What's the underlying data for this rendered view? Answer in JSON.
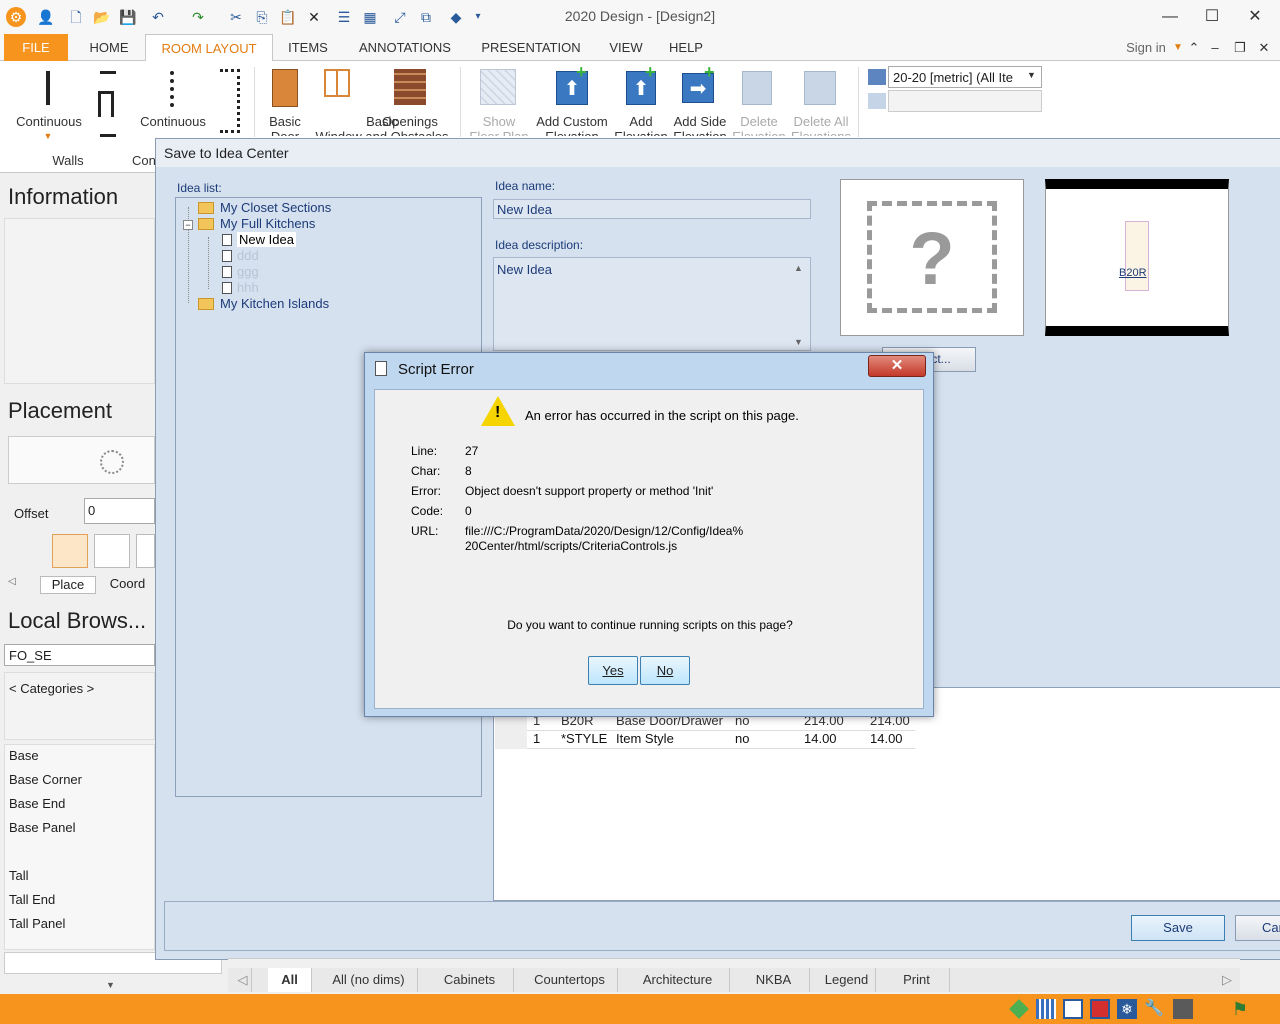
{
  "window": {
    "title": "2020 Design - [Design2]"
  },
  "ribbon_tabs": [
    "FILE",
    "HOME",
    "ROOM LAYOUT",
    "ITEMS",
    "ANNOTATIONS",
    "PRESENTATION",
    "VIEW",
    "HELP"
  ],
  "sign_in": "Sign in",
  "ribbon": {
    "continuous_walls": "Continuous",
    "walls_group": "Walls",
    "continuous2": "Continuous",
    "con_group": "Con",
    "basic_door": "Basic\nDoor",
    "basic_window": "Basic\nWindow and Obstacles",
    "openings": "Openings",
    "show_floor_plan": "Show\nFloor Plan",
    "add_custom_elevation": "Add Custom\nElevation",
    "add_elevation": "Add\nElevation",
    "add_side_elevation": "Add Side\nElevation",
    "delete_elevation": "Delete\nElevation",
    "delete_all_elevations": "Delete All\nElevations",
    "catalog_combo": "20-20 [metric] (All Ite"
  },
  "left": {
    "information": "Information",
    "placement": "Placement",
    "offset_label": "Offset",
    "offset_value": "0",
    "place_tab": "Place",
    "coord_tab": "Coord",
    "local_browser": "Local Brows...",
    "filter_value": "FO_SE",
    "categories": "< Categories >",
    "items": [
      "Base",
      "Base Corner",
      "Base End",
      "Base Panel",
      "",
      "Tall",
      "Tall End",
      "Tall Panel"
    ]
  },
  "save_dialog": {
    "title": "Save to Idea Center",
    "idea_list_label": "Idea list:",
    "tree": [
      "My Closet Sections",
      "My Full Kitchens",
      "New Idea",
      "ddd",
      "ggg",
      "hhh",
      "My Kitchen Islands"
    ],
    "idea_name_label": "Idea name:",
    "idea_name_value": "New Idea",
    "idea_desc_label": "Idea description:",
    "idea_desc_value": "New Idea",
    "select_button": "Select...",
    "preview_label": "B20R",
    "rows": [
      {
        "qty": "1",
        "code": "B20R",
        "desc": "Base Door/Drawer",
        "flag": "no",
        "p1": "214.00",
        "p2": "214.00"
      },
      {
        "qty": "1",
        "code": "*STYLE",
        "desc": "Item Style",
        "flag": "no",
        "p1": "14.00",
        "p2": "14.00"
      }
    ],
    "save_button": "Save",
    "cancel_button": "Car"
  },
  "error_dialog": {
    "title": "Script Error",
    "message": "An error has occurred in the script on this page.",
    "line_label": "Line:",
    "line": "27",
    "char_label": "Char:",
    "char": "8",
    "error_label": "Error:",
    "error": "Object doesn't support property or method 'Init'",
    "code_label": "Code:",
    "code": "0",
    "url_label": "URL:",
    "url": "file:///C:/ProgramData/2020/Design/12/Config/Idea%\n20Center/html/scripts/CriteriaControls.js",
    "question": "Do you want to continue running scripts on this page?",
    "yes": "Yes",
    "no": "No"
  },
  "bottom_tabs": [
    "All",
    "All (no dims)",
    "Cabinets",
    "Countertops",
    "Architecture",
    "NKBA",
    "Legend",
    "Print"
  ]
}
